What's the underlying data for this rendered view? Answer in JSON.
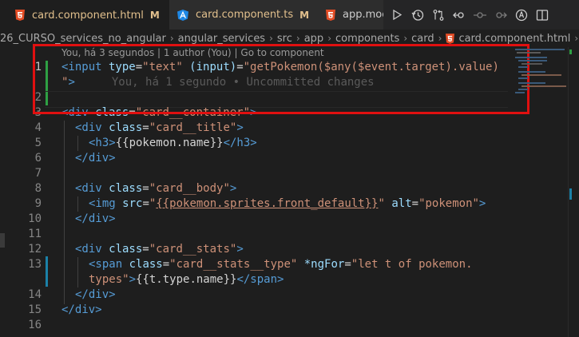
{
  "tabs": [
    {
      "name": "card.component.html",
      "status": "M",
      "icon": "html5-icon",
      "active": true
    },
    {
      "name": "card.component.ts",
      "status": "M",
      "icon": "angular-icon",
      "active": false
    },
    {
      "name": "app.moc",
      "status": "",
      "icon": "html5-icon",
      "active": false
    }
  ],
  "close_glyph": "×",
  "editor_actions": [
    "run-icon",
    "history-icon",
    "compare-changes-icon",
    "go-back-icon",
    "step-icon",
    "step-forward-icon",
    "angular-badge-icon",
    "split-editor-icon"
  ],
  "breadcrumb": [
    "26_CURSO_services_no_angular",
    "angular_services",
    "src",
    "app",
    "components",
    "card",
    "card.component.html"
  ],
  "breadcrumb_sep": "›",
  "codelens": {
    "author_info": "You, há 3 segundos | 1 author (You) |",
    "go_to_component": "Go to component"
  },
  "blame_ghost": "You, há 1 segundo • Uncommitted changes",
  "line_numbers": [
    "1",
    "2",
    "3",
    "4",
    "5",
    "6",
    "7",
    "8",
    "9",
    "10",
    "11",
    "12",
    "13",
    "14",
    "15",
    "16"
  ],
  "code": {
    "l1": {
      "t1": "<input",
      "a1": " type",
      "e1": "=",
      "s1": "\"text\"",
      "a2": " (input)",
      "e2": "=",
      "s2": "\"getPokemon($any($event.target).value)"
    },
    "l1b": {
      "s": "\"",
      "t": ">"
    },
    "l3": {
      "t1": "<div",
      "a": " class",
      "e": "=",
      "s": "\"card__container\"",
      "t2": ">"
    },
    "l4": {
      "t1": "<div",
      "a": " class",
      "e": "=",
      "s": "\"card__title\"",
      "t2": ">"
    },
    "l5": {
      "t1": "<h3>",
      "x": "{{pokemon.name}}",
      "t2": "</h3>"
    },
    "l6": {
      "t": "</div>"
    },
    "l8": {
      "t1": "<div",
      "a": " class",
      "e": "=",
      "s": "\"card__body\"",
      "t2": ">"
    },
    "l9": {
      "t1": "<img",
      "a1": " src",
      "e1": "=",
      "q1": "\"",
      "x": "{{pokemon.sprites.front_default}}",
      "q2": "\"",
      "a2": " alt",
      "e2": "=",
      "s2": "\"pokemon\"",
      "t2": ">"
    },
    "l10": {
      "t": "</div>"
    },
    "l12": {
      "t1": "<div",
      "a": " class",
      "e": "=",
      "s": "\"card__stats\"",
      "t2": ">"
    },
    "l13": {
      "t1": "<span",
      "a1": " class",
      "e1": "=",
      "s1": "\"card__stats__type\"",
      "a2": " *ngFor",
      "e2": "=",
      "s2": "\"let t of pokemon."
    },
    "l13b": {
      "s": "types\"",
      "t1": ">",
      "x": "{{t.type.name}}",
      "t2": "</span>"
    },
    "l14": {
      "t": "</div>"
    },
    "l15": {
      "t": "</div>"
    }
  },
  "colors": {
    "background": "#1e1e1e",
    "tab_bar": "#252526",
    "modified_tab": "#e2c08d",
    "tag": "#569cd6",
    "attribute": "#9cdcfe",
    "string": "#ce9178",
    "added_gutter": "#2ea043",
    "modified_gutter": "#1b81a8",
    "highlight_box": "#e01010"
  }
}
